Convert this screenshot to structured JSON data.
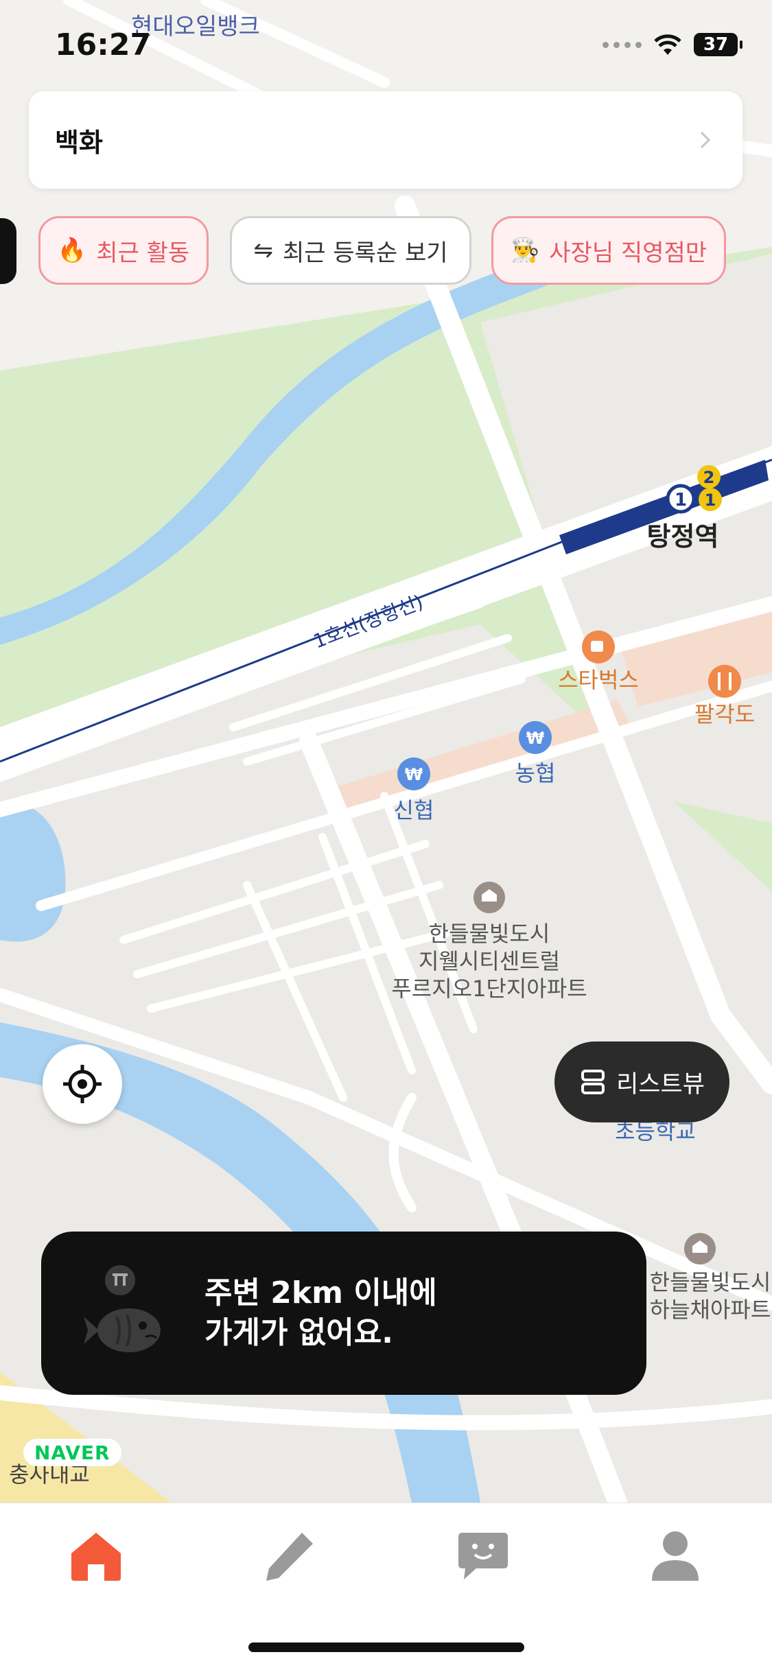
{
  "status": {
    "time": "16:27",
    "battery": "37"
  },
  "search": {
    "query": "백화"
  },
  "filters": [
    {
      "label": "최근 활동",
      "emoji": "🔥"
    },
    {
      "label": "최근 등록순 보기",
      "emoji": "⇋"
    },
    {
      "label": "사장님 직영점만",
      "emoji": "👨‍🍳"
    }
  ],
  "map_labels": {
    "top_bank": "현대오일뱅크",
    "station": "탕정역",
    "line": "1호선(장항선)",
    "starbucks": "스타벅스",
    "palgakdo": "팔각도",
    "nonghyup": "농협",
    "sinhyup": "신협",
    "apartment1": [
      "한들물빛도시",
      "지웰시티센트럴",
      "푸르지오1단지아파트"
    ],
    "school": "초등학교",
    "apartment2": [
      "한들물빛도시",
      "하늘채아파트"
    ],
    "bottom_left": "충사내교",
    "badge_1": "1",
    "badge_2": "2",
    "badge_3": "1"
  },
  "list_view": {
    "label": "리스트뷰"
  },
  "toast": {
    "line1": "주변 2km 이내에",
    "line2": "가게가 없어요."
  },
  "naver_logo": "NAVER",
  "tabs": [
    "home-icon",
    "pencil-icon",
    "chat-icon",
    "profile-icon"
  ],
  "colors": {
    "accent": "#f4593a",
    "station_blue": "#1e3a8a",
    "chip_pink": "#e45a63"
  }
}
